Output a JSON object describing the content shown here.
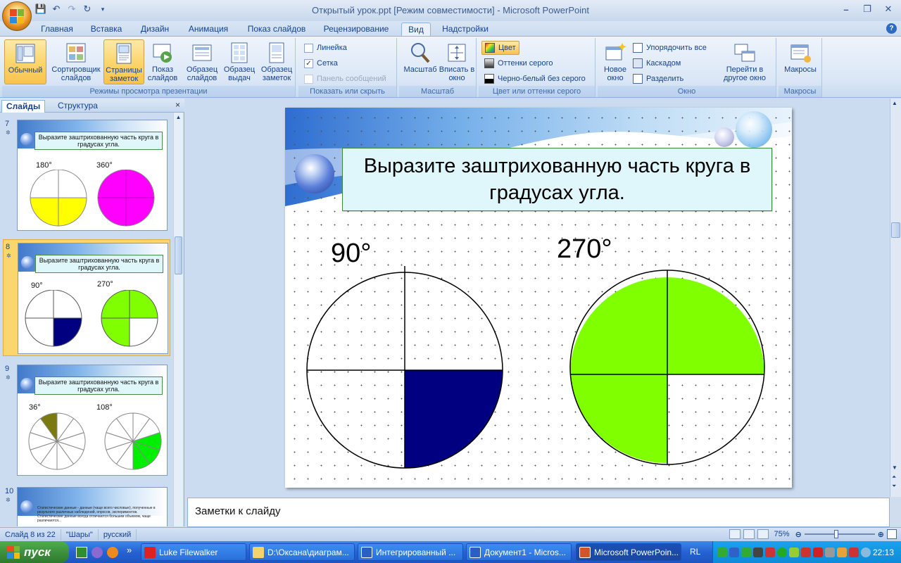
{
  "window": {
    "title": "Открытый урок.ppt [Режим совместимости] - Microsoft PowerPoint"
  },
  "tabs": [
    "Главная",
    "Вставка",
    "Дизайн",
    "Анимация",
    "Показ слайдов",
    "Рецензирование",
    "Вид",
    "Надстройки"
  ],
  "active_tab": "Вид",
  "ribbon": {
    "views": {
      "label": "Режимы просмотра презентации",
      "normal": "Обычный",
      "sorter": "Сортировщик слайдов",
      "notes_page": "Страницы заметок",
      "slideshow": "Показ слайдов",
      "slide_master": "Образец слайдов",
      "handout_master": "Образец выдач",
      "notes_master": "Образец заметок"
    },
    "show_hide": {
      "label": "Показать или скрыть",
      "ruler": "Линейка",
      "grid": "Сетка",
      "msgbar": "Панель сообщений",
      "ruler_checked": false,
      "grid_checked": true,
      "msgbar_checked": false
    },
    "zoom": {
      "label": "Масштаб",
      "zoom": "Масштаб",
      "fit": "Вписать в окно"
    },
    "color": {
      "label": "Цвет или оттенки серого",
      "color": "Цвет",
      "grayscale": "Оттенки серого",
      "bw": "Черно-белый без серого"
    },
    "window": {
      "label": "Окно",
      "new": "Новое окно",
      "arrange": "Упорядочить все",
      "cascade": "Каскадом",
      "split": "Разделить",
      "switch": "Перейти в другое окно"
    },
    "macros": {
      "label": "Макросы",
      "macros": "Макросы"
    }
  },
  "left_panel": {
    "tab_slides": "Слайды",
    "tab_outline": "Структура",
    "close": "×",
    "thumbs": [
      {
        "num": "7",
        "title": "Выразите заштрихованную часть круга в градусах угла.",
        "label_a": "180°",
        "label_b": "360°"
      },
      {
        "num": "8",
        "title": "Выразите заштрихованную часть круга в градусах угла.",
        "label_a": "90°",
        "label_b": "270°"
      },
      {
        "num": "9",
        "title": "Выразите заштрихованную часть круга в градусах угла.",
        "label_a": "36°",
        "label_b": "108°"
      },
      {
        "num": "10",
        "text": "Статистические данные - данные (чаще всего числовые), полученные в результате различных наблюдений, опросов, экспериментов. Статистические данные всегда отличаются большим объемом, чаще различаются..."
      }
    ]
  },
  "slide": {
    "title": "Выразите заштрихованную часть круга в градусах угла.",
    "label_left": "90°",
    "label_right": "270°",
    "left_fill": "#000080",
    "right_fill": "#80ff00"
  },
  "notes": {
    "placeholder": "Заметки к слайду"
  },
  "status": {
    "slide": "Слайд 8 из 22",
    "theme": "\"Шары\"",
    "lang": "русский",
    "zoom": "75%"
  },
  "taskbar": {
    "start": "пуск",
    "items": [
      "Luke Filewalker",
      "D:\\Оксана\\диаграм...",
      "Интегрированный ...",
      "Документ1 - Micros...",
      "Microsoft PowerPoin..."
    ],
    "lang": "RL",
    "clock": "22:13"
  }
}
